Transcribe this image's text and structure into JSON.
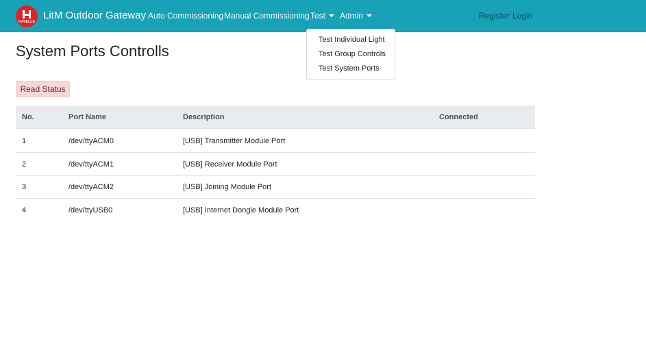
{
  "navbar": {
    "logo_text": "HAVELLS",
    "brand": "LitM Outdoor Gateway",
    "links": {
      "auto_commissioning": "Auto Commissioning",
      "manual_commissioning": "Manual Commissioning",
      "test": "Test",
      "admin": "Admin",
      "register": "Register",
      "login": "Login"
    },
    "test_menu": [
      "Test Individual Light",
      "Test Group Controls",
      "Test System Ports"
    ]
  },
  "page": {
    "title": "System Ports Controlls",
    "read_status_button": "Read Status"
  },
  "table": {
    "headers": [
      "No.",
      "Port Name",
      "Description",
      "Connected"
    ],
    "rows": [
      {
        "no": "1",
        "port": "/dev/ttyACM0",
        "description": "[USB] Transmitter Module Port",
        "connected": ""
      },
      {
        "no": "2",
        "port": "/dev/ttyACM1",
        "description": "[USB] Receiver Module Port",
        "connected": ""
      },
      {
        "no": "3",
        "port": "/dev/ttyACM2",
        "description": "[USB] Joining Module Port",
        "connected": ""
      },
      {
        "no": "4",
        "port": "/dev/ttyUSB0",
        "description": "[USB] Internet Dongle Module Port",
        "connected": ""
      }
    ]
  },
  "colors": {
    "navbar": "#17a2b8",
    "brand_logo": "#e41f28",
    "read_status_bg": "#f8d7da",
    "read_status_text": "#721c24",
    "table_header_bg": "#e9ecef"
  },
  "icons": {
    "logo": "havells-logo-icon",
    "dropdown": "caret-down-icon"
  }
}
